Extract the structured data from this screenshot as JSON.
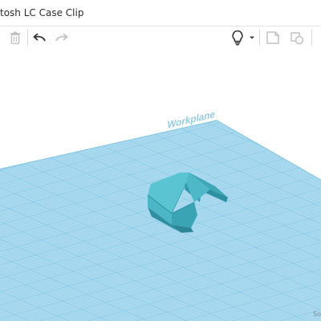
{
  "window": {
    "title": "tosh LC Case Clip"
  },
  "toolbar": {
    "icons": [
      "delete-icon",
      "undo-icon",
      "redo-icon",
      "lightbulb-icon",
      "chevron-down-icon",
      "notes-icon",
      "comment-icon"
    ]
  },
  "workplane": {
    "watermark": "Workplane",
    "snap_label": "So",
    "colors": {
      "grid_fill": "#a9d9ef",
      "grid_line": "#6fbfe0",
      "shape": "#5bc4d3",
      "shape_dark": "#2e8fa0"
    }
  }
}
